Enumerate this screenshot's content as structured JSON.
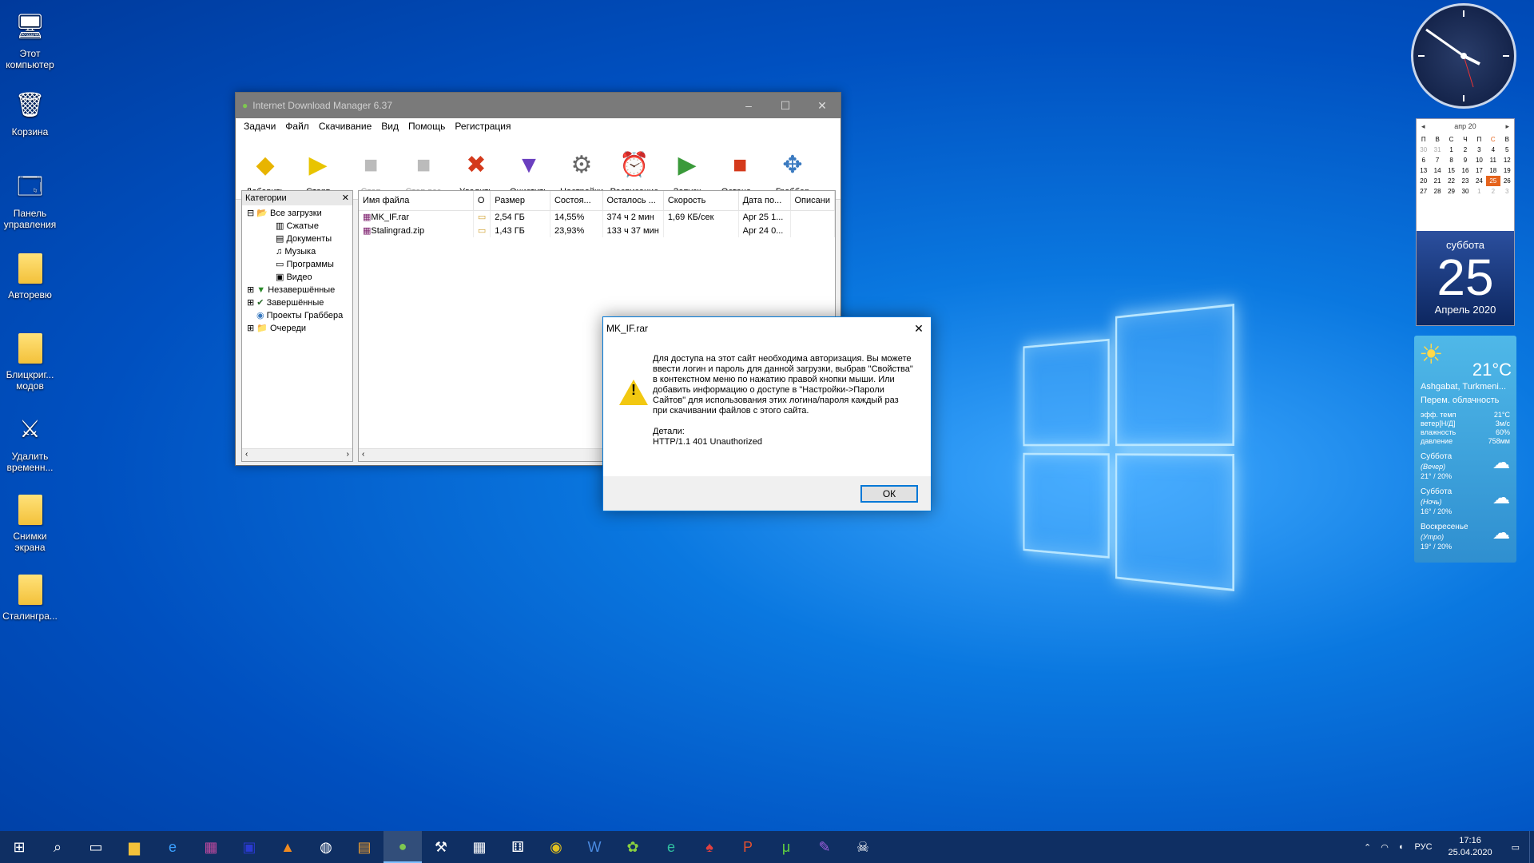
{
  "desktop_icons": [
    {
      "label": "Этот компьютер",
      "icon": "computer-icon"
    },
    {
      "label": "Корзина",
      "icon": "recycle-bin-icon"
    },
    {
      "label": "Панель управления",
      "icon": "control-panel-icon"
    },
    {
      "label": "Авторевю",
      "icon": "folder-icon"
    },
    {
      "label": "Блицкриг... модов",
      "icon": "folder-icon"
    },
    {
      "label": "Удалить временн...",
      "icon": "cleanup-icon"
    },
    {
      "label": "Снимки экрана",
      "icon": "folder-icon"
    },
    {
      "label": "Сталингра...",
      "icon": "folder-icon"
    }
  ],
  "idm": {
    "title": "Internet Download Manager 6.37",
    "menu": [
      "Задачи",
      "Файл",
      "Скачивание",
      "Вид",
      "Помощь",
      "Регистрация"
    ],
    "toolbar": [
      {
        "label": "Добавить",
        "icon": "add-url-icon",
        "enabled": true
      },
      {
        "label": "Старт",
        "icon": "start-icon",
        "enabled": true
      },
      {
        "label": "Стоп",
        "icon": "stop-icon",
        "enabled": false
      },
      {
        "label": "Стоп все",
        "icon": "stop-all-icon",
        "enabled": false
      },
      {
        "label": "Удалить",
        "icon": "delete-icon",
        "enabled": true
      },
      {
        "label": "Очистить",
        "icon": "clear-icon",
        "enabled": true
      },
      {
        "label": "Настройки",
        "icon": "settings-icon",
        "enabled": true
      },
      {
        "label": "Расписание",
        "icon": "scheduler-icon",
        "enabled": true
      },
      {
        "label": "Запуск",
        "icon": "start-queue-icon",
        "enabled": true
      },
      {
        "label": "Остано...",
        "icon": "stop-queue-icon",
        "enabled": true
      },
      {
        "label": "Граббер",
        "icon": "grabber-icon",
        "enabled": true
      }
    ],
    "categories_title": "Категории",
    "tree": {
      "all": "Все загрузки",
      "sub": [
        "Сжатые",
        "Документы",
        "Музыка",
        "Программы",
        "Видео"
      ],
      "top": [
        "Незавершённые",
        "Завершённые",
        "Проекты Граббера",
        "Очереди"
      ]
    },
    "columns": [
      "Имя файла",
      "О",
      "Размер",
      "Состоя...",
      "Осталось ...",
      "Скорость",
      "Дата по...",
      "Описани"
    ],
    "rows": [
      {
        "name": "MK_IF.rar",
        "size": "2,54 ГБ",
        "status": "14,55%",
        "left": "374 ч 2 мин",
        "speed": "1,69 КБ/сек",
        "date": "Apr 25 1...",
        "desc": ""
      },
      {
        "name": "Stalingrad.zip",
        "size": "1,43 ГБ",
        "status": "23,93%",
        "left": "133 ч 37 мин",
        "speed": "",
        "date": "Apr 24 0...",
        "desc": ""
      }
    ]
  },
  "dialog": {
    "title": "MK_IF.rar",
    "message": "Для доступа на этот сайт необходима авторизация. Вы можете ввести логин и пароль для данной загрузки, выбрав \"Свойства\" в контекстном меню по нажатию правой кнопки мыши. Или добавить информацию о доступе в \"Настройки->Пароли Сайтов\" для использования этих логина/пароля каждый раз при скачивании файлов с этого сайта.",
    "details_label": "Детали:",
    "details": "HTTP/1.1 401 Unauthorized",
    "ok": "ОК"
  },
  "calendar": {
    "month": "апр 20",
    "weekdays": [
      "П",
      "В",
      "С",
      "Ч",
      "П",
      "С",
      "В"
    ],
    "weeks": [
      [
        "30",
        "31",
        "1",
        "2",
        "3",
        "4",
        "5"
      ],
      [
        "6",
        "7",
        "8",
        "9",
        "10",
        "11",
        "12"
      ],
      [
        "13",
        "14",
        "15",
        "16",
        "17",
        "18",
        "19"
      ],
      [
        "20",
        "21",
        "22",
        "23",
        "24",
        "25",
        "26"
      ],
      [
        "27",
        "28",
        "29",
        "30",
        "1",
        "2",
        "3"
      ]
    ],
    "today": "25",
    "day_name": "суббота",
    "day_number": "25",
    "month_year": "Апрель 2020"
  },
  "weather": {
    "temp": "21°C",
    "location": "Ashgabat, Turkmeni...",
    "condition": "Перем. облачность",
    "details": [
      {
        "k": "эфф. темп",
        "v": "21°C"
      },
      {
        "k": "ветер[Н/Д]",
        "v": "3м/с"
      },
      {
        "k": "влажность",
        "v": "60%"
      },
      {
        "k": "давление",
        "v": "758мм"
      }
    ],
    "forecast": [
      {
        "day": "Суббота",
        "part": "(Вечер)",
        "vals": "21° / 20%"
      },
      {
        "day": "Суббота",
        "part": "(Ночь)",
        "vals": "16° / 20%"
      },
      {
        "day": "Воскресенье",
        "part": "(Утро)",
        "vals": "19° / 20%"
      }
    ]
  },
  "taskbar": {
    "lang": "РУС",
    "time": "17:16",
    "date": "25.04.2020",
    "apps": [
      "start-icon",
      "search-icon",
      "task-view-icon",
      "explorer-icon",
      "edge-icon",
      "winrar-icon",
      "floppy-icon",
      "avast-icon",
      "globe-icon",
      "archive-icon",
      "idm-icon",
      "axe-icon",
      "calendar-app-icon",
      "dice-icon",
      "chrome-icon",
      "word-icon",
      "bp-icon",
      "ie-e-icon",
      "mushroom-icon",
      "p-icon",
      "utorrent-icon",
      "pen-icon",
      "pirate-icon"
    ]
  }
}
